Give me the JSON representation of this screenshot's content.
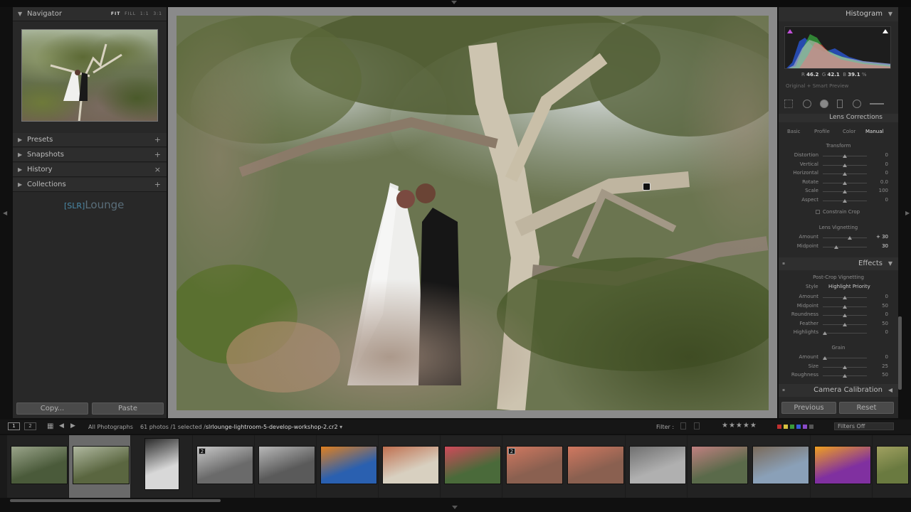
{
  "left_panel": {
    "navigator": {
      "title": "Navigator",
      "modes": [
        "FIT",
        "FILL",
        "1:1",
        "3:1"
      ]
    },
    "sections": [
      {
        "label": "Presets",
        "action": "+"
      },
      {
        "label": "Snapshots",
        "action": "+"
      },
      {
        "label": "History",
        "action": "×"
      },
      {
        "label": "Collections",
        "action": "+"
      }
    ],
    "logo_text": "Lounge",
    "logo_bracket": "[SLR]",
    "copy_label": "Copy...",
    "paste_label": "Paste"
  },
  "right_panel": {
    "histogram_title": "Histogram",
    "readout": {
      "r_label": "R",
      "r": "46.2",
      "g_label": "G",
      "g": "42.1",
      "b_label": "B",
      "b": "39.1",
      "unit": "%"
    },
    "preview_note": "Original + Smart Preview",
    "lens_corrections": {
      "title": "Lens Corrections",
      "tabs": [
        "Basic",
        "Profile",
        "Color",
        "Manual"
      ],
      "active_tab": "Manual",
      "transform_title": "Transform",
      "transform": [
        {
          "label": "Distortion",
          "value": "0",
          "pos": 0.5
        },
        {
          "label": "Vertical",
          "value": "0",
          "pos": 0.5
        },
        {
          "label": "Horizontal",
          "value": "0",
          "pos": 0.5
        },
        {
          "label": "Rotate",
          "value": "0.0",
          "pos": 0.5
        },
        {
          "label": "Scale",
          "value": "100",
          "pos": 0.5
        },
        {
          "label": "Aspect",
          "value": "0",
          "pos": 0.5
        }
      ],
      "constrain_label": "Constrain Crop",
      "vignetting_title": "Lens Vignetting",
      "vignetting": [
        {
          "label": "Amount",
          "value": "+ 30",
          "pos": 0.62
        },
        {
          "label": "Midpoint",
          "value": "30",
          "pos": 0.3
        }
      ]
    },
    "effects": {
      "title": "Effects",
      "post_crop_title": "Post-Crop Vignetting",
      "style_label": "Style",
      "style_value": "Highlight Priority",
      "sliders": [
        {
          "label": "Amount",
          "value": "0",
          "pos": 0.5
        },
        {
          "label": "Midpoint",
          "value": "50",
          "pos": 0.5
        },
        {
          "label": "Roundness",
          "value": "0",
          "pos": 0.5
        },
        {
          "label": "Feather",
          "value": "50",
          "pos": 0.5
        },
        {
          "label": "Highlights",
          "value": "0",
          "pos": 0.05
        }
      ],
      "grain_title": "Grain",
      "grain": [
        {
          "label": "Amount",
          "value": "0",
          "pos": 0.05
        },
        {
          "label": "Size",
          "value": "25",
          "pos": 0.5
        },
        {
          "label": "Roughness",
          "value": "50",
          "pos": 0.5
        }
      ]
    },
    "camera_calibration_title": "Camera Calibration",
    "previous_label": "Previous",
    "reset_label": "Reset"
  },
  "bottom_bar": {
    "page1": "1",
    "page2": "2",
    "source": "All Photographs",
    "count_text": "61 photos /1 selected /",
    "filename": "slrlounge-lightroom-5-develop-workshop-2.cr2",
    "filter_label": "Filter :",
    "filters_off": "Filters Off",
    "stars": "★★★★★"
  },
  "filmstrip": [
    {
      "badge": "",
      "selected": false
    },
    {
      "badge": "",
      "selected": true
    },
    {
      "badge": "",
      "selected": false
    },
    {
      "badge": "2",
      "selected": false
    },
    {
      "badge": "",
      "selected": false
    },
    {
      "badge": "",
      "selected": false
    },
    {
      "badge": "",
      "selected": false
    },
    {
      "badge": "",
      "selected": false
    },
    {
      "badge": "2",
      "selected": false
    },
    {
      "badge": "",
      "selected": false
    },
    {
      "badge": "",
      "selected": false
    },
    {
      "badge": "",
      "selected": false
    },
    {
      "badge": "",
      "selected": false
    },
    {
      "badge": "",
      "selected": false
    },
    {
      "badge": "",
      "selected": false
    }
  ],
  "colors": {
    "accent_yellow": "#d8c040",
    "label_red": "#c03030",
    "label_green": "#3a9a3a",
    "label_blue": "#3a5ad8",
    "logo_blue": "#4a8aa8"
  }
}
